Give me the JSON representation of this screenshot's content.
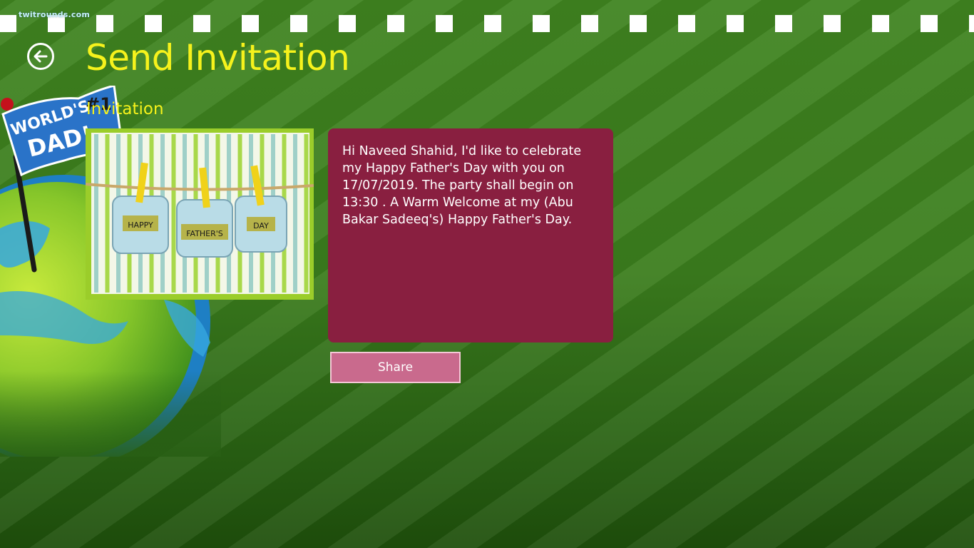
{
  "watermark": "twitrounds.com",
  "header": {
    "title": "Send Invitation",
    "back_icon": "back-arrow-icon"
  },
  "decoration": {
    "flag_text": "WORLD'S #1 DAD!",
    "flag_line1": "WORLD'S",
    "flag_line2": "DAD!",
    "flag_hash": "#1"
  },
  "invitation": {
    "section_label": "Invitation",
    "card_words": [
      "HAPPY",
      "FATHER'S",
      "DAY"
    ],
    "message": "Hi Naveed Shahid, I'd like to celebrate my Happy Father's Day with you on 17/07/2019. The party shall begin on 13:30 . A Warm Welcome at my (Abu Bakar Sadeeq's) Happy Father's Day.",
    "share_label": "Share"
  },
  "colors": {
    "accent_title": "#f6f21c",
    "message_bg": "#891f40",
    "share_bg": "#c96a8d",
    "background": "#3a7a1c"
  }
}
